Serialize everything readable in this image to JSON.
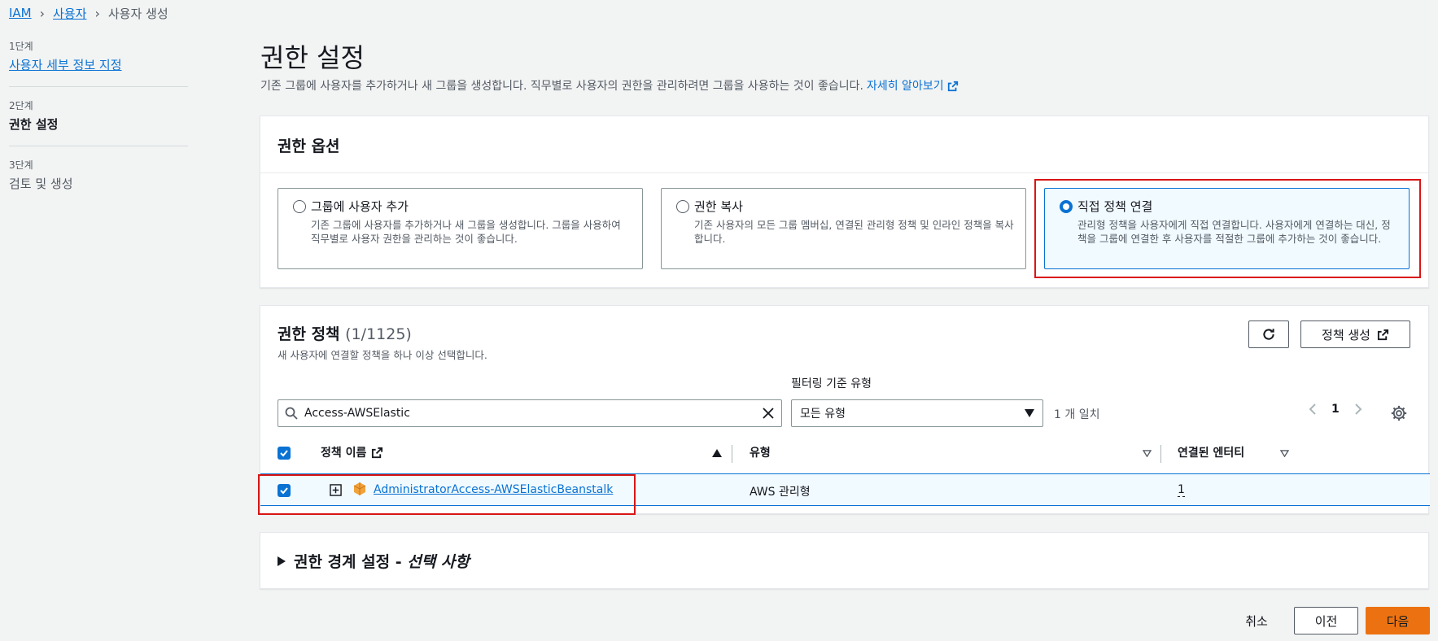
{
  "breadcrumb": {
    "root": "IAM",
    "users": "사용자",
    "current": "사용자 생성"
  },
  "steps": [
    {
      "label": "1단계",
      "title": "사용자 세부 정보 지정"
    },
    {
      "label": "2단계",
      "title": "권한 설정"
    },
    {
      "label": "3단계",
      "title": "검토 및 생성"
    }
  ],
  "page": {
    "title": "권한 설정",
    "description": "기존 그룹에 사용자를 추가하거나 새 그룹을 생성합니다. 직무별로 사용자의 권한을 관리하려면 그룹을 사용하는 것이 좋습니다.",
    "learn_more": "자세히 알아보기"
  },
  "permission_options": {
    "header": "권한 옵션",
    "options": [
      {
        "title": "그룹에 사용자 추가",
        "desc": "기존 그룹에 사용자를 추가하거나 새 그룹을 생성합니다. 그룹을 사용하여 직무별로 사용자 권한을 관리하는 것이 좋습니다.",
        "selected": false
      },
      {
        "title": "권한 복사",
        "desc": "기존 사용자의 모든 그룹 멤버십, 연결된 관리형 정책 및 인라인 정책을 복사합니다.",
        "selected": false
      },
      {
        "title": "직접 정책 연결",
        "desc": "관리형 정책을 사용자에게 직접 연결합니다. 사용자에게 연결하는 대신, 정책을 그룹에 연결한 후 사용자를 적절한 그룹에 추가하는 것이 좋습니다.",
        "selected": true
      }
    ]
  },
  "policies": {
    "title": "권한 정책",
    "count": "(1/1125)",
    "description": "새 사용자에 연결할 정책을 하나 이상 선택합니다.",
    "create_policy": "정책 생성",
    "filter_label": "필터링 기준 유형",
    "search_value": "Access-AWSElastic",
    "type_select": "모든 유형",
    "match_count": "1 개 일치",
    "page_number": "1",
    "columns": {
      "name": "정책 이름",
      "type": "유형",
      "entities": "연결된 엔터티"
    },
    "rows": [
      {
        "name": "AdministratorAccess-AWSElasticBeanstalk",
        "type": "AWS 관리형",
        "entities": "1",
        "checked": true
      }
    ]
  },
  "boundary": {
    "title": "권한 경계 설정 - ",
    "title_italic": "선택 사항"
  },
  "footer": {
    "cancel": "취소",
    "previous": "이전",
    "next": "다음"
  },
  "colors": {
    "accent": "#0972d3",
    "primary_button": "#ec7211",
    "highlight": "#d91515"
  }
}
